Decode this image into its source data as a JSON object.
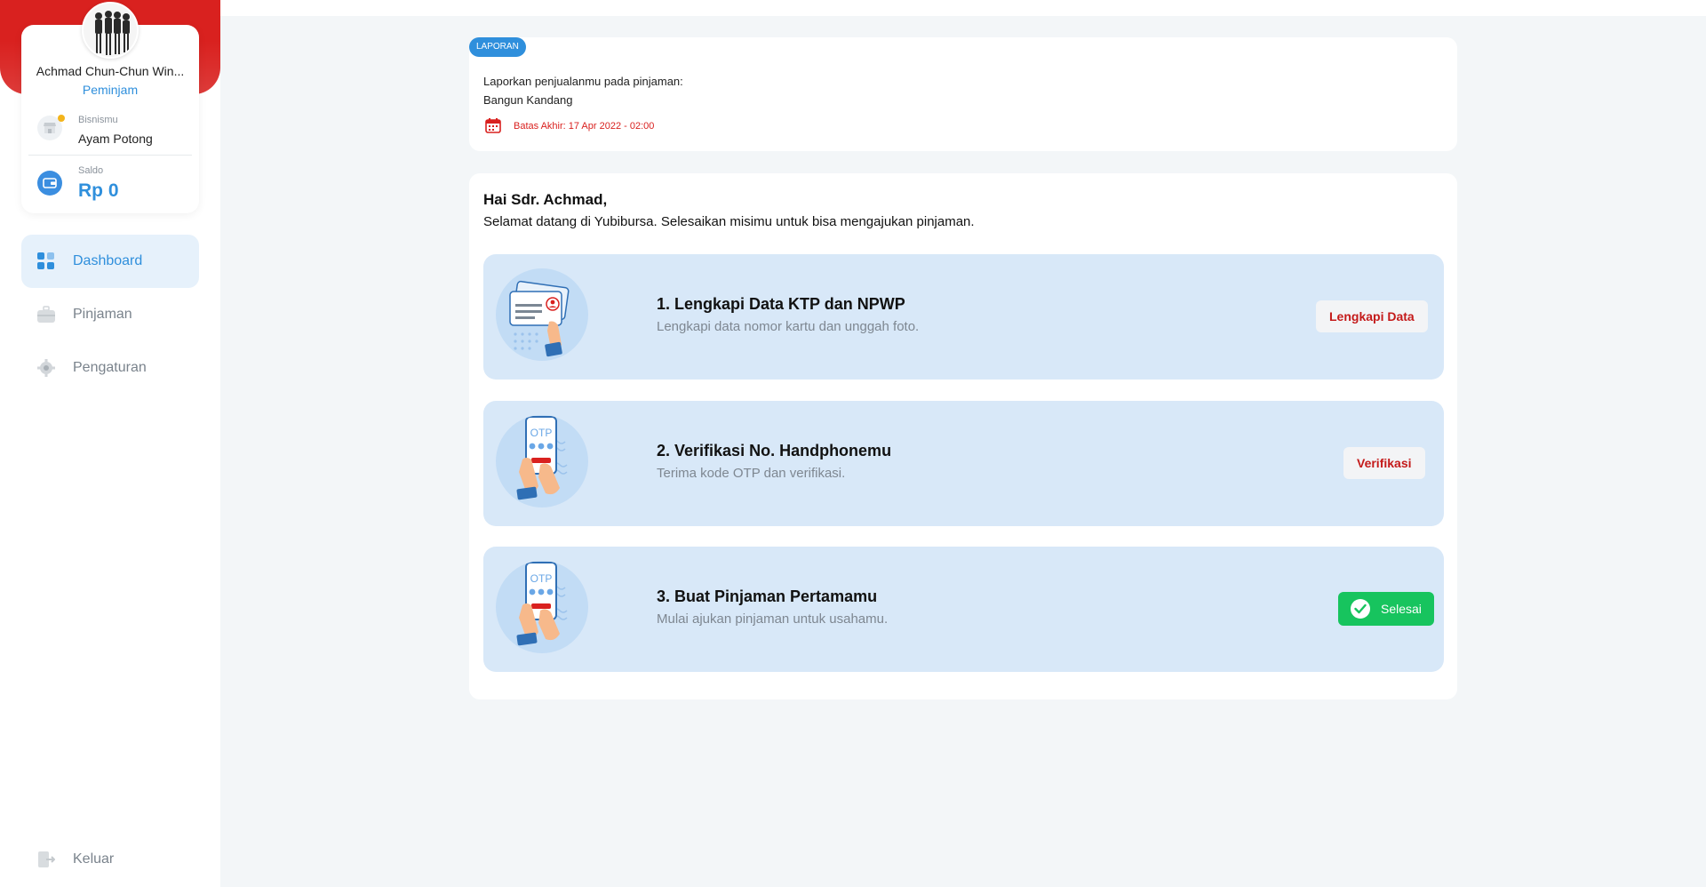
{
  "profile": {
    "name": "Achmad Chun-Chun Win...",
    "role": "Peminjam",
    "business_label": "Bisnismu",
    "business_value": "Ayam Potong",
    "saldo_label": "Saldo",
    "saldo_value": "Rp 0"
  },
  "nav": {
    "dashboard": "Dashboard",
    "pinjaman": "Pinjaman",
    "pengaturan": "Pengaturan",
    "keluar": "Keluar"
  },
  "report": {
    "badge": "LAPORAN",
    "line1": "Laporkan penjualanmu pada pinjaman:",
    "line2": "Bangun Kandang",
    "deadline": "Batas Akhir: 17 Apr 2022 - 02:00"
  },
  "greeting": {
    "title": "Hai Sdr. Achmad,",
    "subtitle": "Selamat datang di Yubibursa. Selesaikan misimu untuk bisa mengajukan pinjaman."
  },
  "missions": [
    {
      "title": "1. Lengkapi Data KTP dan NPWP",
      "desc": "Lengkapi data nomor kartu dan unggah foto.",
      "button": "Lengkapi Data",
      "icon": "id-card-icon"
    },
    {
      "title": "2. Verifikasi No. Handphonemu",
      "desc": "Terima kode OTP dan verifikasi.",
      "button": "Verifikasi",
      "icon": "otp-phone-icon",
      "otp": "OTP"
    },
    {
      "title": "3. Buat Pinjaman Pertamamu",
      "desc": "Mulai ajukan pinjaman untuk usahamu.",
      "button": "Selesai",
      "icon": "otp-phone-icon",
      "otp": "OTP"
    }
  ],
  "colors": {
    "brand_red": "#d9211f",
    "accent_blue": "#2f8fdc",
    "mission_bg": "#d8e8f8",
    "success_green": "#17c45e"
  }
}
